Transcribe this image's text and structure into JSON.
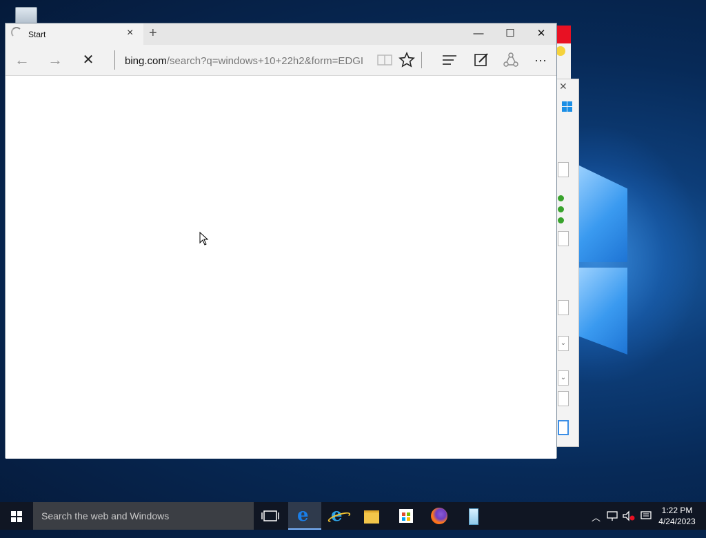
{
  "browser": {
    "tab_title": "Start",
    "tab_close": "×",
    "new_tab": "+",
    "minimize": "—",
    "maximize": "☐",
    "close": "✕",
    "address_domain": "bing.com",
    "address_path": "/search?q=windows+10+22h2&form=EDGI",
    "nav_back": "←",
    "nav_forward": "→",
    "stop": "✕",
    "more": "···"
  },
  "taskbar": {
    "search_placeholder": "Search the web and Windows",
    "time": "1:22 PM",
    "date": "4/24/2023"
  },
  "icons": [
    "recycle-bin-icon",
    "edge-icon",
    "internet-explorer-icon",
    "file-explorer-icon",
    "store-icon",
    "firefox-icon",
    "app-icon"
  ]
}
